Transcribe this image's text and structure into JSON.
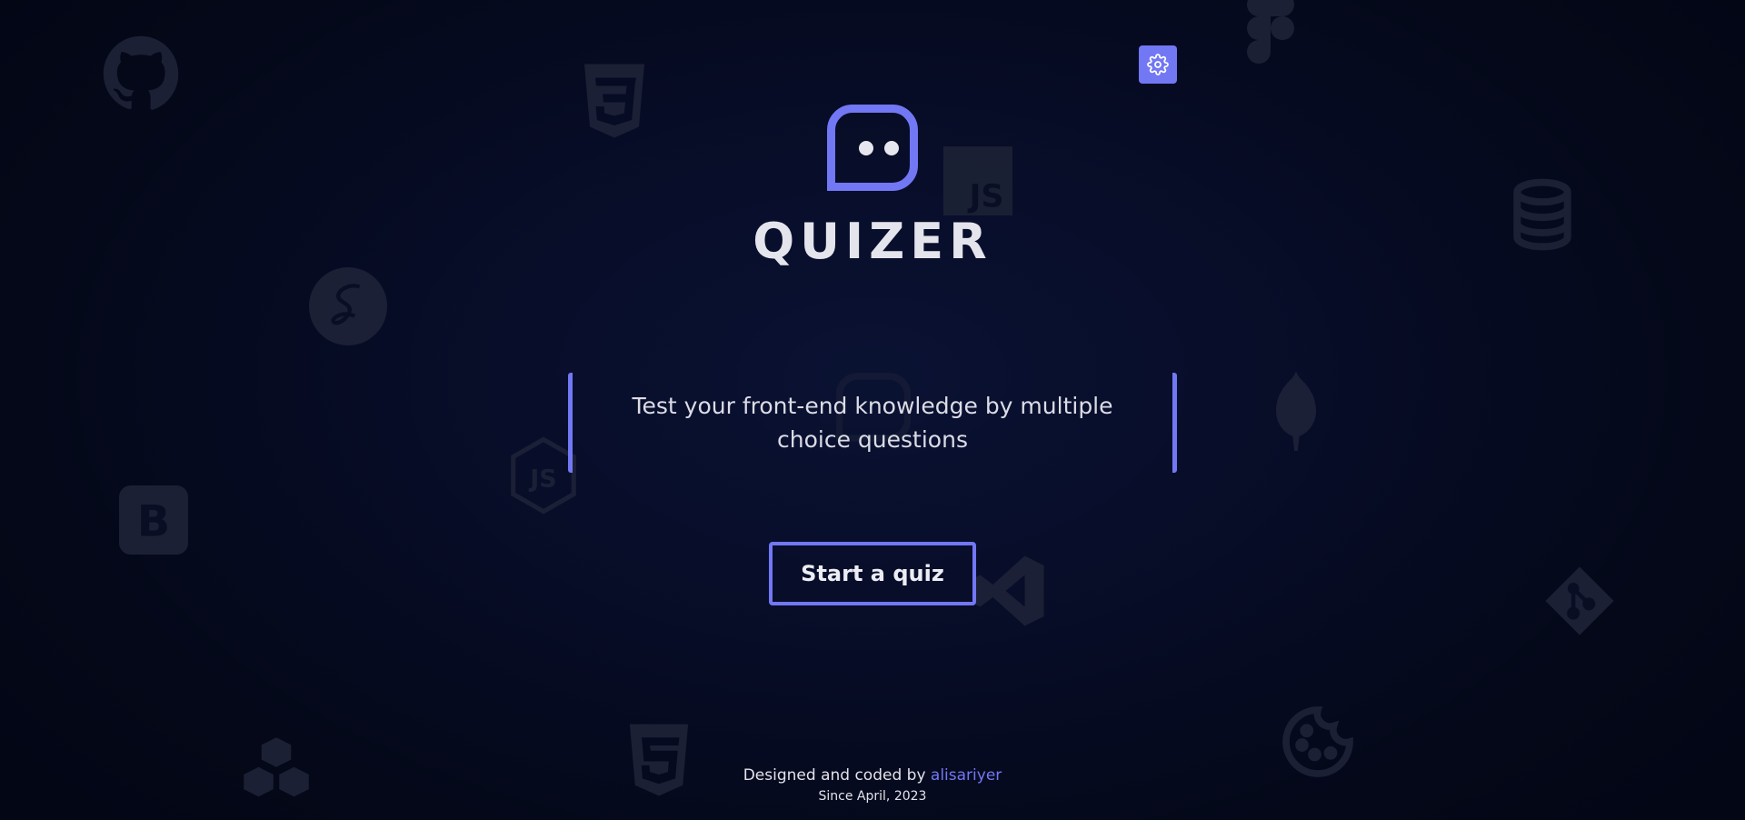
{
  "app": {
    "title": "QUIZER",
    "tagline": "Test your front-end knowledge by multiple choice questions",
    "start_button_label": "Start a quiz"
  },
  "footer": {
    "designed_by_prefix": "Designed and coded by",
    "author": "alisariyer",
    "since": "Since April, 2023"
  },
  "settings": {
    "icon": "gear-icon"
  },
  "background_icons": [
    "github-icon",
    "css3-icon",
    "figma-icon",
    "js-icon",
    "database-icon",
    "sass-icon",
    "mongodb-leaf-icon",
    "nodejs-icon",
    "bootstrap-icon",
    "vscode-icon",
    "git-icon",
    "blocks-icon",
    "html5-icon",
    "cookie-icon"
  ],
  "colors": {
    "accent": "#7277f4",
    "background": "#050a22",
    "text": "#e4e4ec"
  }
}
